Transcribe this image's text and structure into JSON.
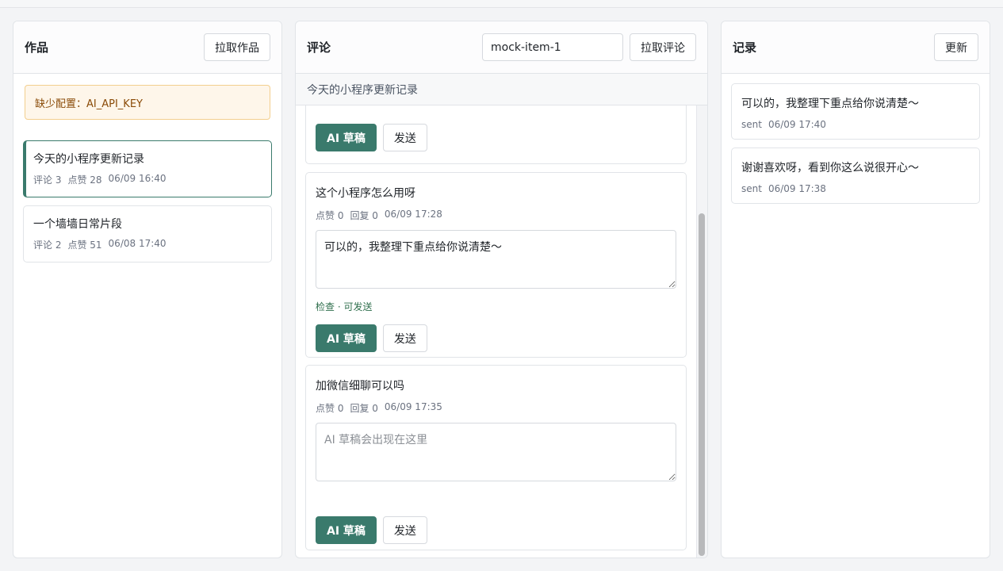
{
  "works_panel": {
    "title": "作品",
    "fetch_button": "拉取作品",
    "warning": "缺少配置：AI_API_KEY",
    "items": [
      {
        "title": "今天的小程序更新记录",
        "comments": "评论 3",
        "likes": "点赞 28",
        "time": "06/09 16:40",
        "active": true
      },
      {
        "title": "一个墙墙日常片段",
        "comments": "评论 2",
        "likes": "点赞 51",
        "time": "06/08 17:40",
        "active": false
      }
    ]
  },
  "comments_panel": {
    "title": "评论",
    "item_id_value": "mock-item-1",
    "fetch_button": "拉取评论",
    "current_work_title": "今天的小程序更新记录",
    "ai_draft_button": "AI 草稿",
    "send_button": "发送",
    "comments": [
      {
        "text": "这个小程序怎么用呀",
        "likes": "点赞 0",
        "replies": "回复 0",
        "time": "06/09 17:28",
        "draft": "可以的，我整理下重点给你说清楚～",
        "check": "检查 · 可发送"
      },
      {
        "text": "加微信细聊可以吗",
        "likes": "点赞 0",
        "replies": "回复 0",
        "time": "06/09 17:35",
        "draft": "",
        "placeholder": "AI 草稿会出现在这里"
      }
    ]
  },
  "records_panel": {
    "title": "记录",
    "refresh_button": "更新",
    "items": [
      {
        "text": "可以的，我整理下重点给你说清楚～",
        "status": "sent",
        "time": "06/09 17:40"
      },
      {
        "text": "谢谢喜欢呀，看到你这么说很开心～",
        "status": "sent",
        "time": "06/09 17:38"
      }
    ]
  },
  "colors": {
    "accent": "#3a7a6c",
    "warning_bg": "#fef6ea",
    "warning_text": "#8a4b08",
    "ok_text": "#2f6f4d"
  }
}
